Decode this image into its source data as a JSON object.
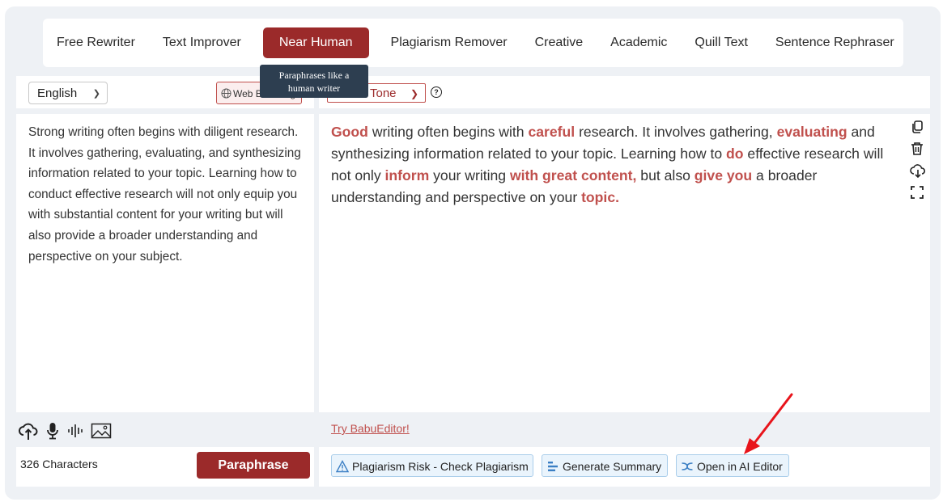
{
  "tabs": [
    {
      "label": "Free Rewriter",
      "active": false
    },
    {
      "label": "Text Improver",
      "active": false
    },
    {
      "label": "Near Human",
      "active": true
    },
    {
      "label": "Plagiarism Remover",
      "active": false
    },
    {
      "label": "Creative",
      "active": false
    },
    {
      "label": "Academic",
      "active": false
    },
    {
      "label": "Quill Text",
      "active": false
    },
    {
      "label": "Sentence Rephraser",
      "active": false
    }
  ],
  "tooltip": {
    "line1": "Paraphrases like a",
    "line2": "human writer"
  },
  "input": {
    "language": "English",
    "web_button": "Web Browsing",
    "text": "Strong writing often begins with diligent research. It involves gathering, evaluating, and synthesizing information related to your topic. Learning how to conduct effective research will not only equip you with substantial content for your writing but will also provide a broader understanding and perspective on your subject.",
    "char_count": "326 Characters",
    "paraphrase_label": "Paraphrase"
  },
  "output": {
    "tone_label": "Tone",
    "segments": [
      {
        "text": "Good",
        "highlight": true
      },
      {
        "text": " writing often begins with ",
        "highlight": false
      },
      {
        "text": "careful",
        "highlight": true
      },
      {
        "text": " research. It involves gathering, ",
        "highlight": false
      },
      {
        "text": "evaluating",
        "highlight": true
      },
      {
        "text": " and synthesizing information related to your topic. Learning how to ",
        "highlight": false
      },
      {
        "text": "do",
        "highlight": true
      },
      {
        "text": " effective research will not only ",
        "highlight": false
      },
      {
        "text": "inform",
        "highlight": true
      },
      {
        "text": " your writing ",
        "highlight": false
      },
      {
        "text": "with great content,",
        "highlight": true
      },
      {
        "text": " but also ",
        "highlight": false
      },
      {
        "text": "give you",
        "highlight": true
      },
      {
        "text": " a broader understanding and perspective on your ",
        "highlight": false
      },
      {
        "text": "topic.",
        "highlight": true
      }
    ],
    "try_link": "Try BabuEditor!",
    "actions": {
      "plagiarism": "Plagiarism Risk - Check Plagiarism",
      "summary": "Generate Summary",
      "ai_editor": "Open in AI Editor"
    }
  },
  "colors": {
    "accent": "#9b2a2a",
    "highlight": "#c0504d",
    "annotation_arrow": "#e8141b"
  }
}
